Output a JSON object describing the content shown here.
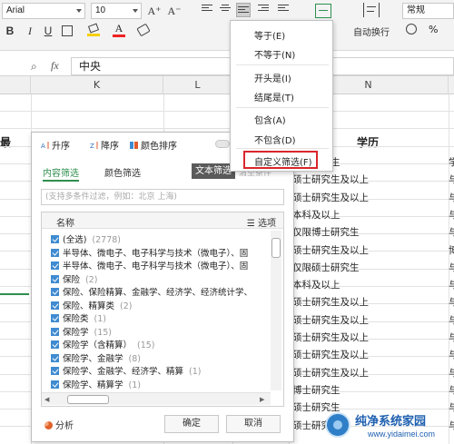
{
  "ribbon": {
    "font_name": "Arial",
    "font_size": "10",
    "grow_font": "A⁺",
    "shrink_font": "A⁻",
    "bold": "B",
    "italic": "I",
    "underline": "U",
    "wrap_text_label": "自动换行",
    "number_format": "常规"
  },
  "formula_bar": {
    "fx_label": "fx",
    "cell_value": "中央"
  },
  "columns": [
    "K",
    "L",
    "N"
  ],
  "grid": {
    "header_edu": "学历",
    "header_left": "最",
    "col_n_values": [
      "博士研究生",
      "硕士研究生及以上",
      "硕士研究生及以上",
      "本科及以上",
      "仅限博士研究生",
      "硕士研究生及以上",
      "仅限硕士研究生",
      "本科及以上",
      "硕士研究生及以上",
      "硕士研究生及以上",
      "硕士研究生及以上",
      "硕士研究生及以上",
      "硕士研究生及以上",
      "博士研究生",
      "硕士研究生",
      "硕士研究生"
    ],
    "col_right_values": [
      "学",
      "与",
      "与",
      "与",
      "与",
      "博",
      "与",
      "与",
      "与",
      "与",
      "与",
      "与",
      "与",
      "与",
      "与",
      "与"
    ]
  },
  "filter_panel": {
    "sort_asc": "升序",
    "sort_desc": "降序",
    "sort_color": "颜色排序",
    "tab_content": "内容筛选",
    "tab_color": "颜色筛选",
    "tab_text": "文本筛选",
    "tab_clear": "清空条件",
    "search_placeholder": "(支持多条件过滤，例如：北京 上海)",
    "list_header_name": "名称",
    "list_header_options": "选项",
    "items": [
      {
        "label": "(全选)",
        "count": "(2778)"
      },
      {
        "label": "半导体、微电子、电子科学与技术（微电子）、固",
        "count": ""
      },
      {
        "label": "半导体、微电子、电子科学与技术（微电子）、固",
        "count": ""
      },
      {
        "label": "保险",
        "count": "(2)"
      },
      {
        "label": "保险、保险精算、金融学、经济学、经济统计学、",
        "count": ""
      },
      {
        "label": "保险、精算类",
        "count": "(2)"
      },
      {
        "label": "保险类",
        "count": "(1)"
      },
      {
        "label": "保险学",
        "count": "(15)"
      },
      {
        "label": "保险学（含精算）",
        "count": "(15)"
      },
      {
        "label": "保险学、金融学",
        "count": "(8)"
      },
      {
        "label": "保险学、金融学、经济学、精算",
        "count": "(1)"
      },
      {
        "label": "保险学、精算学",
        "count": "(1)"
      }
    ],
    "analysis_label": "分析",
    "ok_label": "确定",
    "cancel_label": "取消"
  },
  "context_menu": {
    "items": [
      "等于(E)",
      "不等于(N)",
      "开头是(I)",
      "结尾是(T)",
      "包含(A)",
      "不包含(D)",
      "自定义筛选(F)"
    ]
  },
  "watermark": {
    "title": "纯净系统家园",
    "url": "www.yidaimei.com"
  },
  "colors": {
    "accent_green": "#2f8f4e",
    "checkbox_blue": "#3f8bd1",
    "highlight_red": "#d9262c"
  }
}
